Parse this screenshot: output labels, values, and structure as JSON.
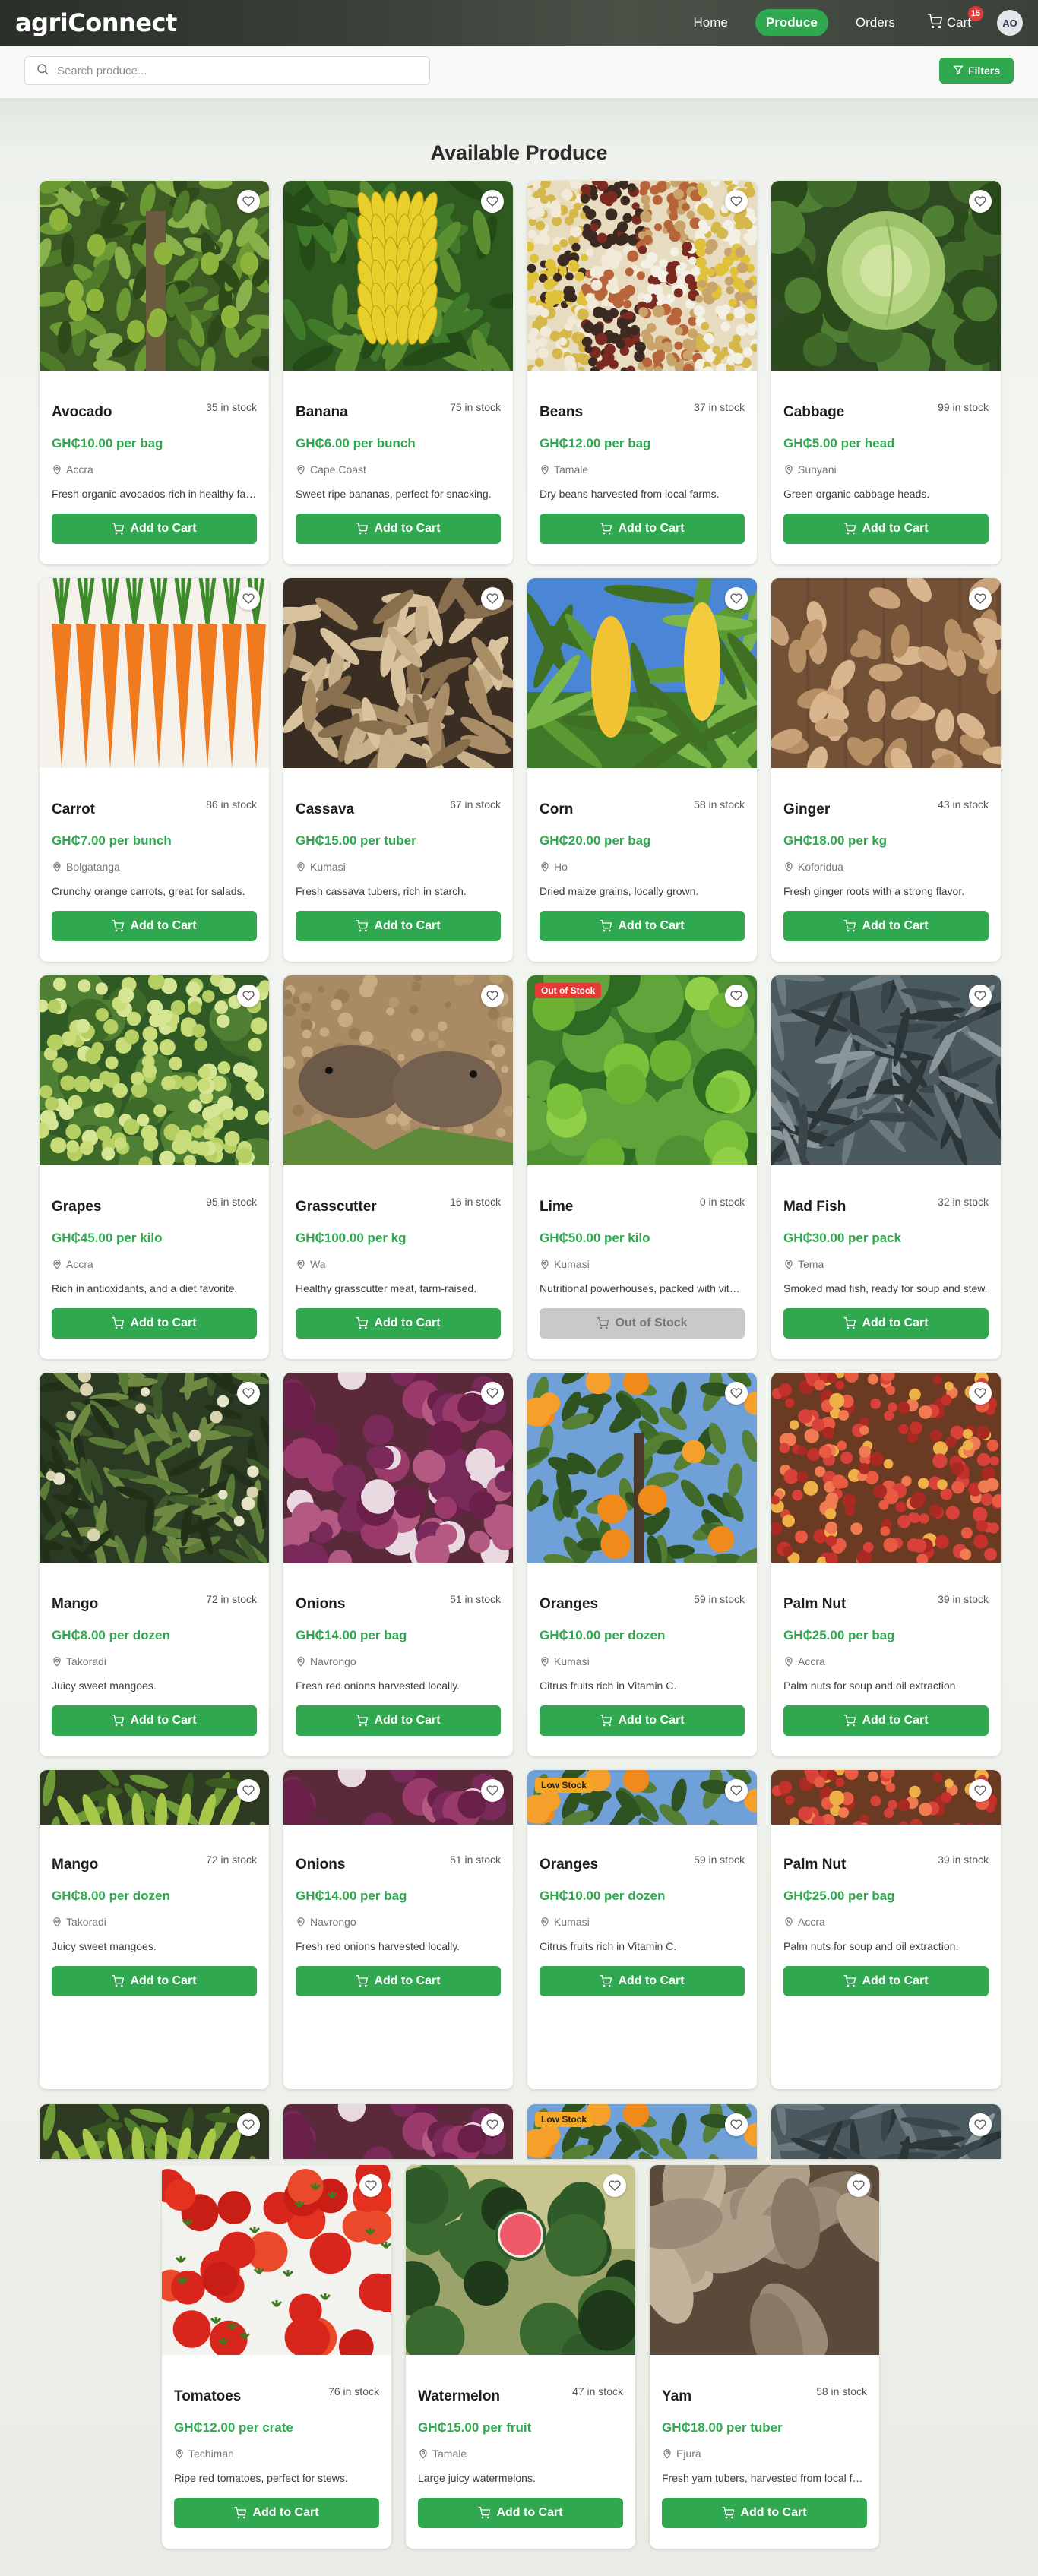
{
  "header": {
    "brand": "agriConnect",
    "nav": [
      {
        "label": "Home"
      },
      {
        "label": "Produce"
      },
      {
        "label": "Orders"
      },
      {
        "label": "Cart"
      }
    ],
    "cart_count": "15",
    "avatar_initials": "AO"
  },
  "search": {
    "placeholder": "Search produce..."
  },
  "filters": {
    "label": "Filters"
  },
  "section_title": "Available Produce",
  "colors": {
    "accent": "#2fa84f",
    "out_of_stock_badge": "#e53935",
    "low_stock_badge": "#f5a623"
  },
  "products": [
    {
      "name": "Avocado",
      "stock": "35 in stock",
      "price": "GH₵10.00 per bag",
      "location": "Accra",
      "description": "Fresh organic avocados rich in healthy fats.",
      "button": "Add to Cart",
      "badge": "",
      "image": "avocado-tree"
    },
    {
      "name": "Banana",
      "stock": "75 in stock",
      "price": "GH₵6.00 per bunch",
      "location": "Cape Coast",
      "description": "Sweet ripe bananas, perfect for snacking.",
      "button": "Add to Cart",
      "badge": "",
      "image": "banana-bunch"
    },
    {
      "name": "Beans",
      "stock": "37 in stock",
      "price": "GH₵12.00 per bag",
      "location": "Tamale",
      "description": "Dry beans harvested from local farms.",
      "button": "Add to Cart",
      "badge": "",
      "image": "beans-mix"
    },
    {
      "name": "Cabbage",
      "stock": "99 in stock",
      "price": "GH₵5.00 per head",
      "location": "Sunyani",
      "description": "Green organic cabbage heads.",
      "button": "Add to Cart",
      "badge": "",
      "image": "cabbage"
    },
    {
      "name": "Carrot",
      "stock": "86 in stock",
      "price": "GH₵7.00 per bunch",
      "location": "Bolgatanga",
      "description": "Crunchy orange carrots, great for salads.",
      "button": "Add to Cart",
      "badge": "",
      "image": "carrots"
    },
    {
      "name": "Cassava",
      "stock": "67 in stock",
      "price": "GH₵15.00 per tuber",
      "location": "Kumasi",
      "description": "Fresh cassava tubers, rich in starch.",
      "button": "Add to Cart",
      "badge": "",
      "image": "cassava"
    },
    {
      "name": "Corn",
      "stock": "58 in stock",
      "price": "GH₵20.00 per bag",
      "location": "Ho",
      "description": "Dried maize grains, locally grown.",
      "button": "Add to Cart",
      "badge": "",
      "image": "corn"
    },
    {
      "name": "Ginger",
      "stock": "43 in stock",
      "price": "GH₵18.00 per kg",
      "location": "Koforidua",
      "description": "Fresh ginger roots with a strong flavor.",
      "button": "Add to Cart",
      "badge": "",
      "image": "ginger"
    },
    {
      "name": "Grapes",
      "stock": "95 in stock",
      "price": "GH₵45.00 per kilo",
      "location": "Accra",
      "description": "Rich in antioxidants, and a diet favorite.",
      "button": "Add to Cart",
      "badge": "",
      "image": "grapes"
    },
    {
      "name": "Grasscutter",
      "stock": "16 in stock",
      "price": "GH₵100.00 per kg",
      "location": "Wa",
      "description": "Healthy grasscutter meat, farm-raised.",
      "button": "Add to Cart",
      "badge": "",
      "image": "grasscutter"
    },
    {
      "name": "Lime",
      "stock": "0 in stock",
      "price": "GH₵50.00 per kilo",
      "location": "Kumasi",
      "description": "Nutritional powerhouses, packed with vitamin C.",
      "button": "Out of Stock",
      "badge": "Out of Stock",
      "image": "lime"
    },
    {
      "name": "Mad Fish",
      "stock": "32 in stock",
      "price": "GH₵30.00 per pack",
      "location": "Tema",
      "description": "Smoked mad fish, ready for soup and stew.",
      "button": "Add to Cart",
      "badge": "",
      "image": "fish"
    },
    {
      "name": "Mango",
      "stock": "72 in stock",
      "price": "GH₵8.00 per dozen",
      "location": "Takoradi",
      "description": "Juicy sweet mangoes.",
      "button": "Add to Cart",
      "badge": "",
      "image": "mango-tree"
    },
    {
      "name": "Onions",
      "stock": "51 in stock",
      "price": "GH₵14.00 per bag",
      "location": "Navrongo",
      "description": "Fresh red onions harvested locally.",
      "button": "Add to Cart",
      "badge": "",
      "image": "onions"
    },
    {
      "name": "Oranges",
      "stock": "59 in stock",
      "price": "GH₵10.00 per dozen",
      "location": "Kumasi",
      "description": "Citrus fruits rich in Vitamin C.",
      "button": "Add to Cart",
      "badge": "",
      "image": "orange-tree"
    },
    {
      "name": "Palm Nut",
      "stock": "39 in stock",
      "price": "GH₵25.00 per bag",
      "location": "Accra",
      "description": "Palm nuts for soup and oil extraction.",
      "button": "Add to Cart",
      "badge": "",
      "image": "palm-nut"
    },
    {
      "name": "Mango",
      "stock": "72 in stock",
      "price": "GH₵8.00 per dozen",
      "location": "Takoradi",
      "description": "Juicy sweet mangoes.",
      "button": "Add to Cart",
      "badge": "",
      "image": "mango-plantain"
    },
    {
      "name": "Onions",
      "stock": "51 in stock",
      "price": "GH₵14.00 per bag",
      "location": "Navrongo",
      "description": "Fresh red onions harvested locally.",
      "button": "Add to Cart",
      "badge": "",
      "image": "onions"
    },
    {
      "name": "Oranges",
      "stock": "59 in stock",
      "price": "GH₵10.00 per dozen",
      "location": "Kumasi",
      "description": "Citrus fruits rich in Vitamin C.",
      "button": "Add to Cart",
      "badge": "Low Stock",
      "image": "orange-tree"
    },
    {
      "name": "Palm Nut",
      "stock": "39 in stock",
      "price": "GH₵25.00 per bag",
      "location": "Accra",
      "description": "Palm nuts for soup and oil extraction.",
      "button": "Add to Cart",
      "badge": "",
      "image": "palm-nut"
    },
    {
      "name": "",
      "stock": "",
      "price": "",
      "location": "",
      "description": "",
      "button": "",
      "badge": "",
      "image": "mango-plantain"
    },
    {
      "name": "",
      "stock": "",
      "price": "",
      "location": "",
      "description": "",
      "button": "",
      "badge": "",
      "image": "onions"
    },
    {
      "name": "",
      "stock": "",
      "price": "",
      "location": "",
      "description": "",
      "button": "",
      "badge": "Low Stock",
      "image": "orange-tree"
    },
    {
      "name": "",
      "stock": "",
      "price": "",
      "location": "",
      "description": "",
      "button": "",
      "badge": "",
      "image": "fish"
    },
    {
      "name": "Tomatoes",
      "stock": "76 in stock",
      "price": "GH₵12.00 per crate",
      "location": "Techiman",
      "description": "Ripe red tomatoes, perfect for stews.",
      "button": "Add to Cart",
      "badge": "",
      "image": "tomatoes"
    },
    {
      "name": "Watermelon",
      "stock": "47 in stock",
      "price": "GH₵15.00 per fruit",
      "location": "Tamale",
      "description": "Large juicy watermelons.",
      "button": "Add to Cart",
      "badge": "",
      "image": "watermelon"
    },
    {
      "name": "Yam",
      "stock": "58 in stock",
      "price": "GH₵18.00 per tuber",
      "location": "Ejura",
      "description": "Fresh yam tubers, harvested from local farms.",
      "button": "Add to Cart",
      "badge": "",
      "image": "yam"
    }
  ]
}
